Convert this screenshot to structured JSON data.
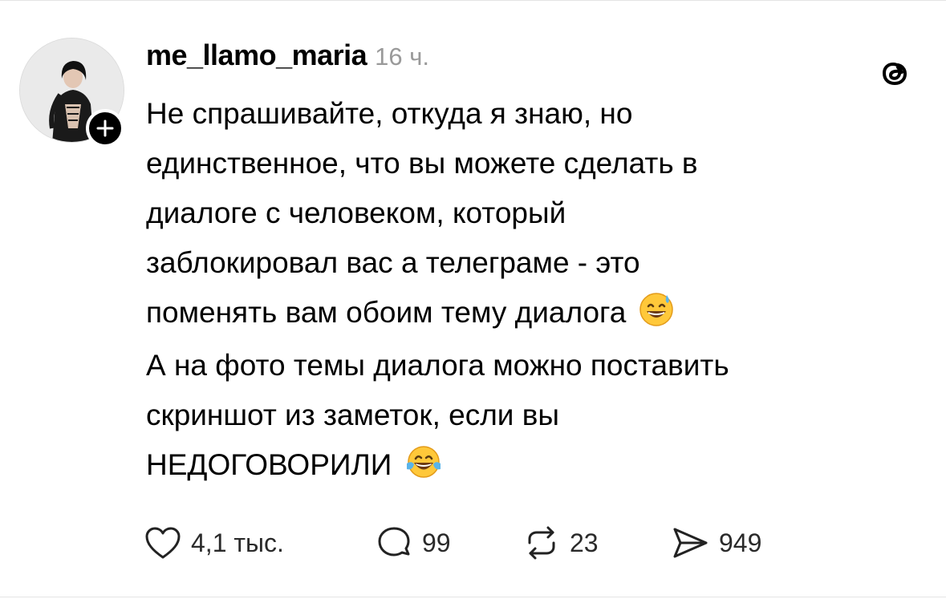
{
  "post": {
    "author": {
      "username": "me_llamo_maria",
      "time": "16 ч."
    },
    "text_paragraph_1": [
      "Не спрашивайте, откуда я знаю, но",
      "единственное, что вы можете сделать в",
      "диалоге с человеком, который",
      "заблокировал вас а телеграме - это",
      "поменять вам обоим тему диалога"
    ],
    "text_paragraph_2": [
      "А на фото темы диалога можно поставить",
      "скриншот из заметок, если вы",
      "НЕДОГОВОРИЛИ"
    ],
    "emojis": [
      "grinning-sweat-emoji",
      "tears-of-joy-emoji"
    ],
    "stats": {
      "likes": "4,1 тыс.",
      "comments": "99",
      "reposts": "23",
      "shares": "949"
    }
  },
  "icons": [
    "plus-icon",
    "threads-logo-icon",
    "heart-icon",
    "comment-icon",
    "repost-icon",
    "share-icon"
  ],
  "colors": {
    "text": "#000000",
    "muted": "#9a9a9a",
    "counts": "#2a2a2a",
    "background": "#ffffff"
  }
}
